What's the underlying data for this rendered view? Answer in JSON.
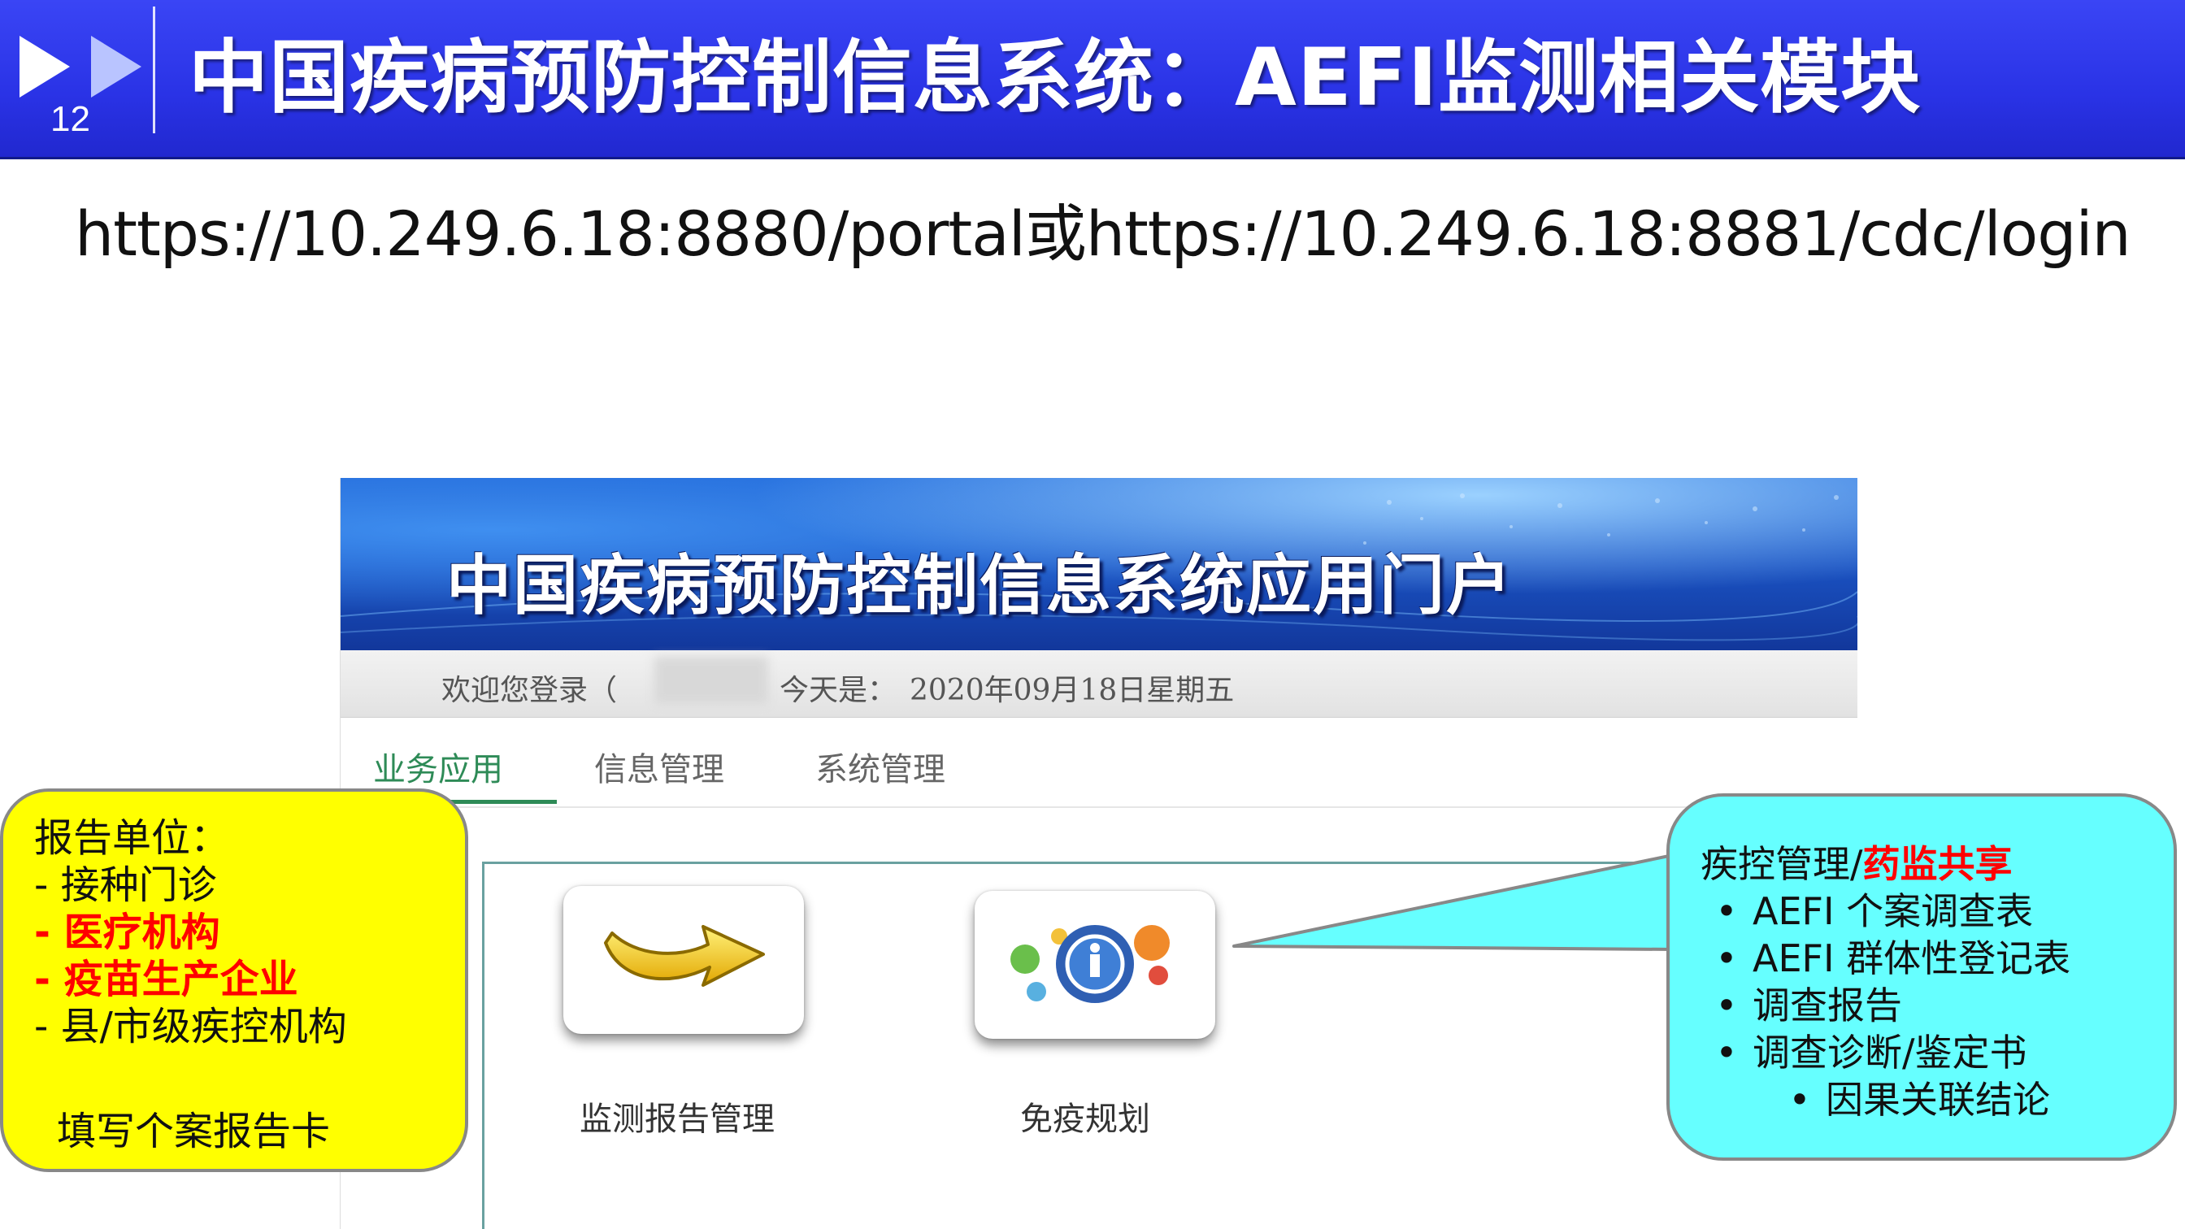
{
  "slide": {
    "number": "12",
    "title": "中国疾病预防控制信息系统：AEFI监测相关模块",
    "url": "https://10.249.6.18:8880/portal或https://10.249.6.18:8881/cdc/login"
  },
  "portal": {
    "banner_title": "中国疾病预防控制信息系统应用门户",
    "welcome_label": "欢迎您登录（",
    "today_label": "今天是：",
    "today_value": "2020年09月18日星期五",
    "tabs": [
      "业务应用",
      "信息管理",
      "系统管理"
    ],
    "active_tab": "业务应用",
    "apps": [
      {
        "label": "监测报告管理",
        "icon": "arrow-icon"
      },
      {
        "label": "免疫规划",
        "icon": "immunization-icon"
      }
    ]
  },
  "callout_left": {
    "title": "报告单位：",
    "items": [
      "- 接种门诊",
      "- 医疗机构",
      "- 疫苗生产企业",
      "- 县/市级疾控机构"
    ],
    "highlighted": [
      "- 医疗机构",
      "- 疫苗生产企业"
    ],
    "footer": "填写个案报告卡",
    "bg": "#ffff00"
  },
  "callout_right": {
    "title_prefix": "疾控管理/",
    "title_highlight": "药监共享",
    "items": [
      "AEFI 个案调查表",
      "AEFI 群体性登记表",
      "调查报告",
      "调查诊断/鉴定书"
    ],
    "subitems": [
      "因果关联结论"
    ],
    "bullet": "•",
    "bg": "#66ffff"
  },
  "colors": {
    "header": "#2a33e6",
    "highlight": "#ff0000",
    "tab_active": "#2e8b57"
  }
}
